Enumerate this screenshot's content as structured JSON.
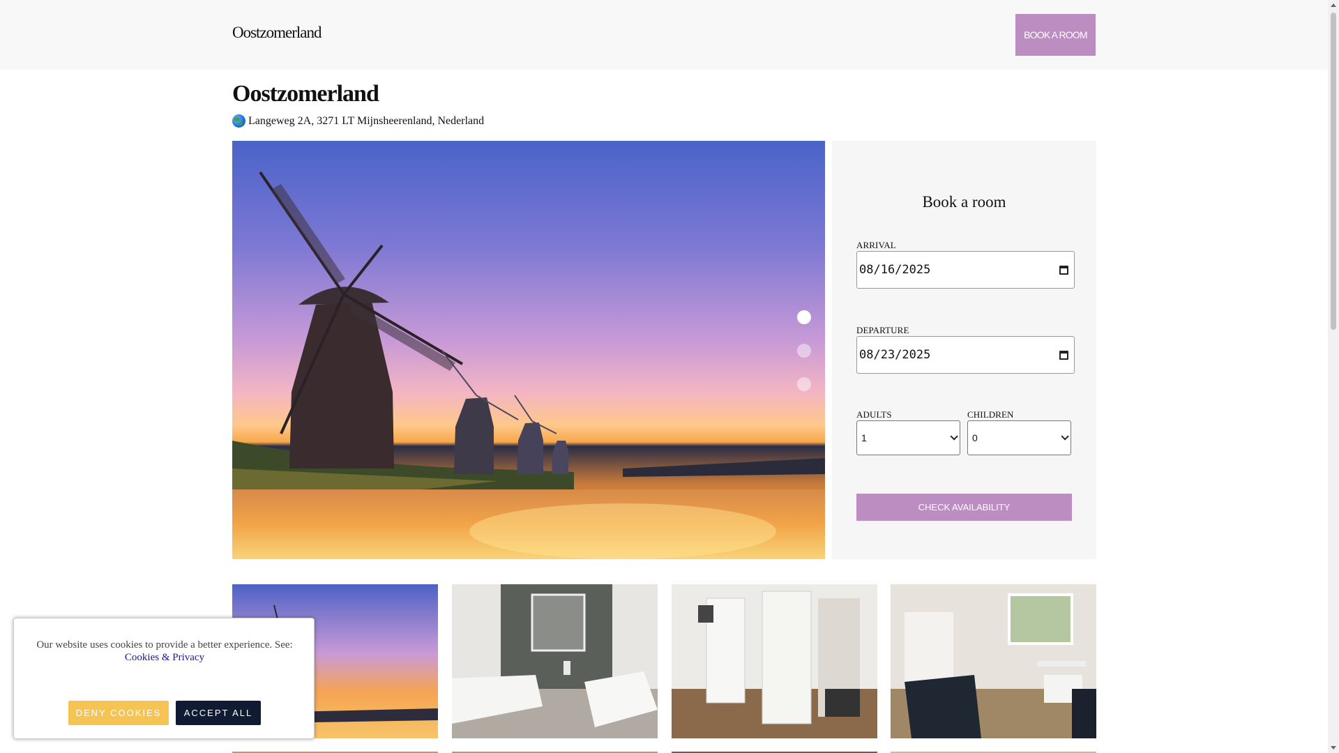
{
  "header": {
    "brand": "Oostzomerland",
    "book_button": "BOOK A ROOM"
  },
  "property": {
    "title": "Oostzomerland",
    "address": "Langeweg 2A, 3271 LT Mijnsheerenland, Nederland",
    "address_icon": "globe-icon"
  },
  "carousel": {
    "slide_count": 3,
    "active_index": 0
  },
  "booking": {
    "title": "Book a room",
    "arrival_label": "ARRIVAL",
    "arrival_value": "08/16/2025",
    "departure_label": "DEPARTURE",
    "departure_value": "08/23/2025",
    "adults_label": "ADULTS",
    "adults_value": "1",
    "children_label": "CHILDREN",
    "children_value": "0",
    "check_button": "CHECK AVAILABILITY"
  },
  "cookie_banner": {
    "message": "Our website uses cookies to provide a better experience. See:",
    "link_text": "Cookies & Privacy",
    "deny_button": "DENY COOKIES",
    "accept_button": "ACCEPT ALL"
  },
  "colors": {
    "accent": "#bb8dc0",
    "deny": "#f6c453",
    "accept": "#101a33"
  }
}
